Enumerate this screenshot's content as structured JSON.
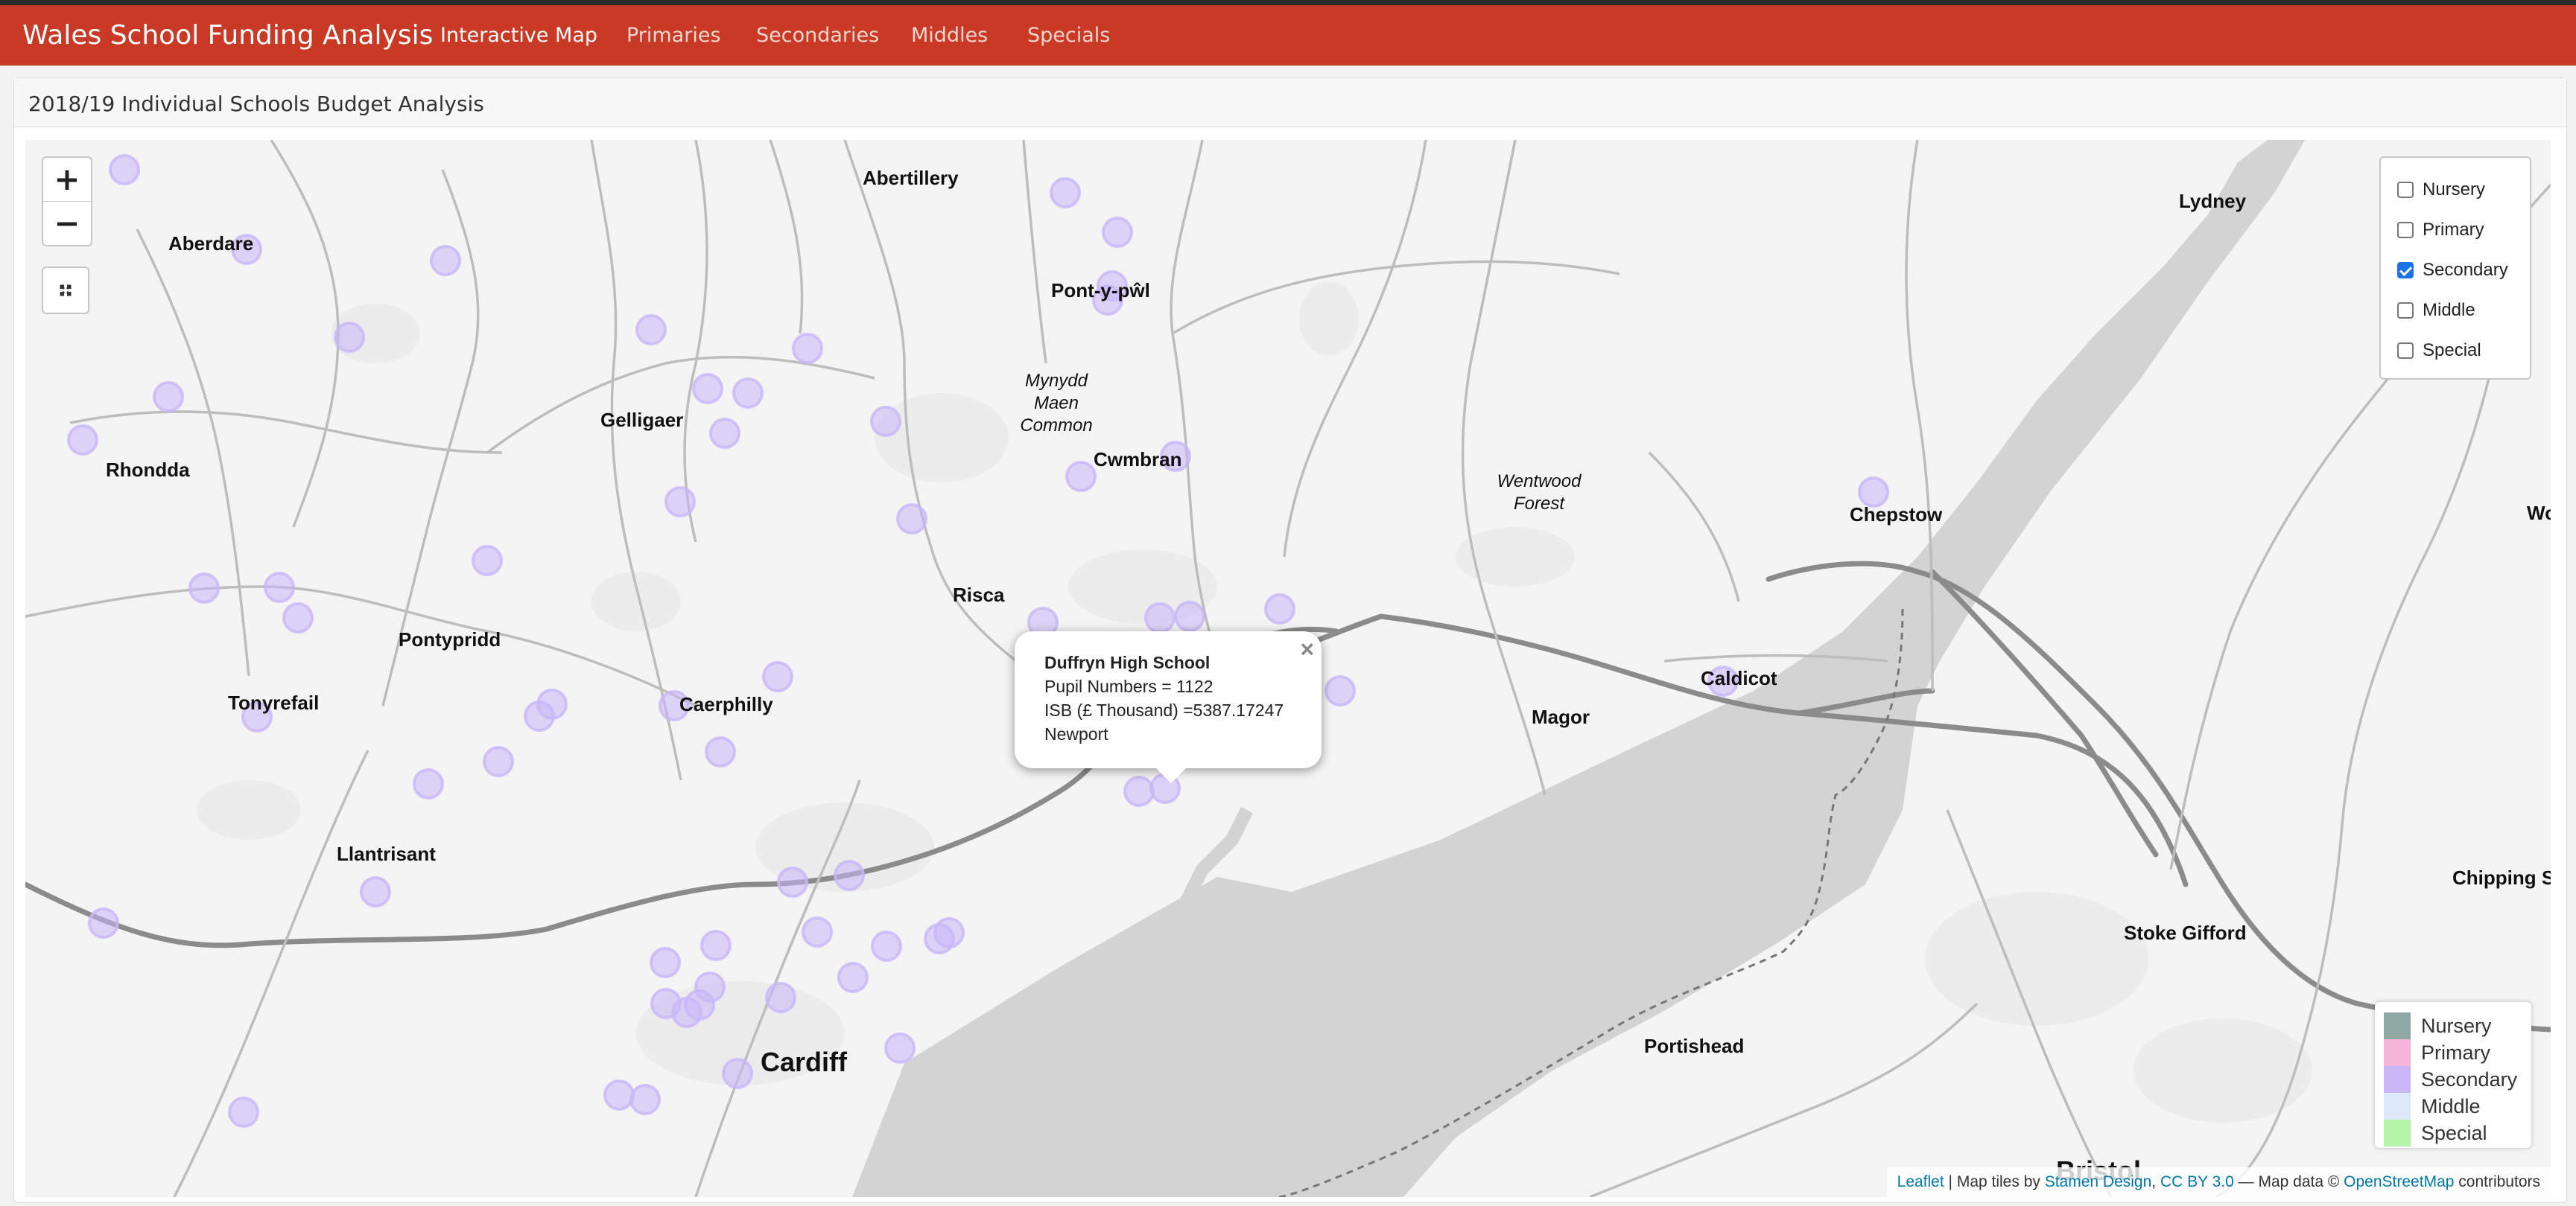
{
  "navbar": {
    "brand": "Wales School Funding Analysis",
    "links": [
      "Interactive Map",
      "Primaries",
      "Secondaries",
      "Middles",
      "Specials"
    ],
    "active": "Interactive Map"
  },
  "panel": {
    "title": "2018/19 Individual Schools Budget Analysis"
  },
  "map": {
    "places": [
      "Abertillery",
      "Aberdare",
      "Pont-y-pŵl",
      "Lydney",
      "Gelligaer",
      "Rhondda",
      "Cwmbran",
      "Chepstow",
      "Risca",
      "Pontypridd",
      "Tonyrefail",
      "Caerphilly",
      "Caldicot",
      "Magor",
      "Llantrisant",
      "Cardiff",
      "Portishead",
      "Stoke Gifford",
      "Bristol",
      "Chipping So",
      "Wo"
    ],
    "italic_places": [
      "Mynydd\nMaen\nCommon",
      "Wentwood\nForest"
    ],
    "zoom_in": "+",
    "zoom_out": "−",
    "layer_control": [
      {
        "label": "Nursery",
        "checked": false
      },
      {
        "label": "Primary",
        "checked": false
      },
      {
        "label": "Secondary",
        "checked": true
      },
      {
        "label": "Middle",
        "checked": false
      },
      {
        "label": "Special",
        "checked": false
      }
    ],
    "legend": [
      {
        "label": "Nursery",
        "color": "#8fa8a4"
      },
      {
        "label": "Primary",
        "color": "#f7b6d9"
      },
      {
        "label": "Secondary",
        "color": "#c8b6f7"
      },
      {
        "label": "Middle",
        "color": "#dde9f9"
      },
      {
        "label": "Special",
        "color": "#b4f5a8"
      }
    ],
    "marker_color": "#c8b6f7",
    "popup": {
      "school": "Duffryn High School",
      "pupils": "Pupil Numbers = 1122",
      "isb": "ISB (£ Thousand) =5387.17247",
      "area": "Newport",
      "close": "×"
    },
    "attribution": {
      "leaflet": "Leaflet",
      "sep1": " | Map tiles by ",
      "stamen": "Stamen Design",
      "comma": ", ",
      "license": "CC BY 3.0",
      "sep2": " — Map data © ",
      "osm": "OpenStreetMap",
      "tail": " contributors"
    }
  }
}
